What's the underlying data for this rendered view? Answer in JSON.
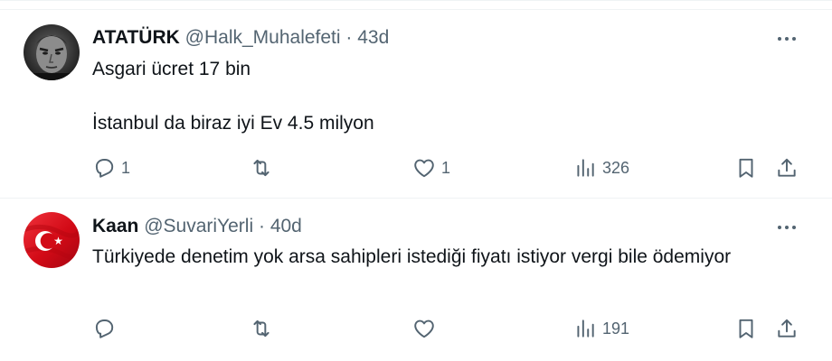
{
  "tweets": [
    {
      "name": "ATATÜRK",
      "handle": "@Halk_Muhalefeti",
      "separator": "·",
      "time": "43d",
      "text_lines": [
        "Asgari ücret 17 bin",
        "İstanbul da biraz iyi Ev 4.5 milyon"
      ],
      "replies": "1",
      "retweets": "",
      "likes": "1",
      "views": "326",
      "avatar": "portrait-photo"
    },
    {
      "name": "Kaan",
      "handle": "@SuvariYerli",
      "separator": "·",
      "time": "40d",
      "text": "Türkiyede denetim yok arsa sahipleri istediği fiyatı istiyor vergi bile ödemiyor",
      "replies": "",
      "retweets": "",
      "likes": "",
      "views": "191",
      "avatar": "turkish-flag"
    }
  ],
  "icons": {
    "reply": "reply-icon",
    "retweet": "retweet-icon",
    "like": "heart-icon",
    "views": "views-icon",
    "bookmark": "bookmark-icon",
    "share": "share-icon",
    "more": "more-icon"
  },
  "colors": {
    "text": "#0f1419",
    "secondary": "#536471",
    "divider": "#eff3f4",
    "flag_red": "#e30a17"
  }
}
